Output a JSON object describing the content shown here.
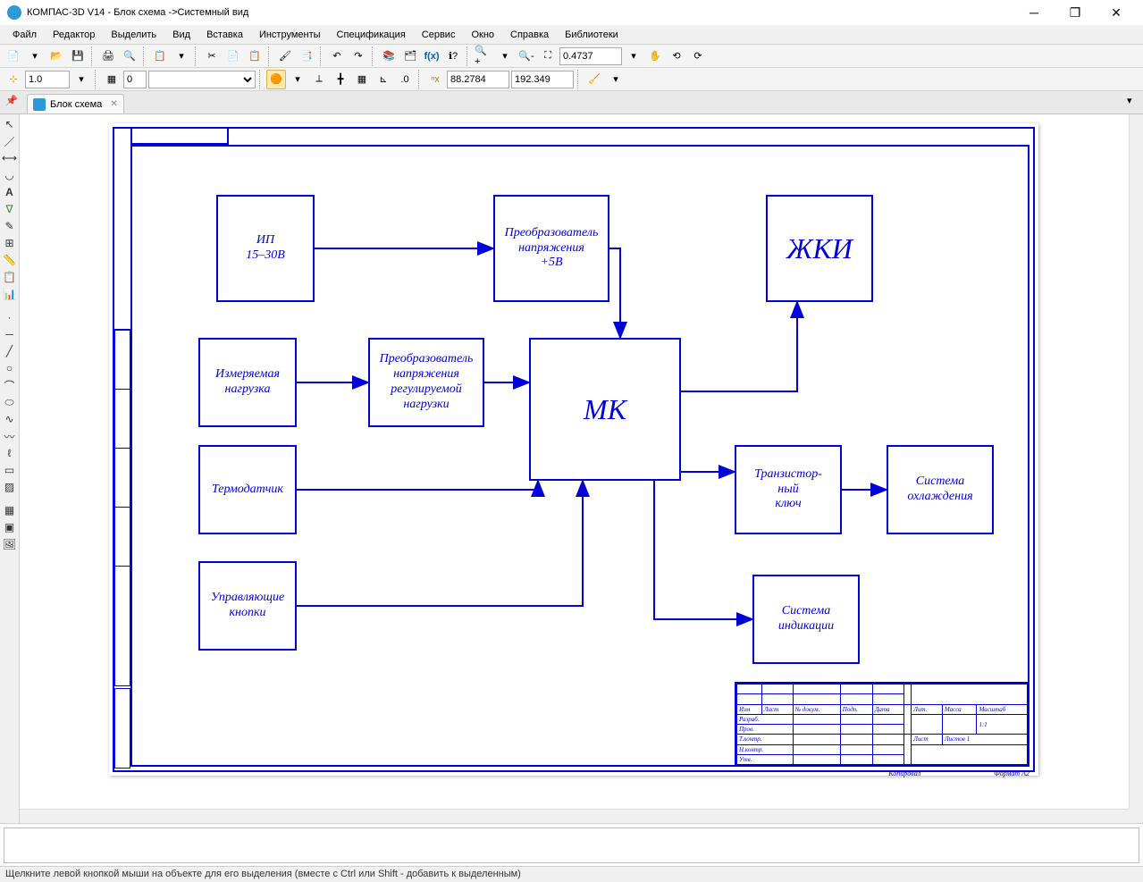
{
  "window": {
    "title": "КОМПАС-3D V14 - Блок схема ->Системный вид"
  },
  "menu": {
    "items": [
      "Файл",
      "Редактор",
      "Выделить",
      "Вид",
      "Вставка",
      "Инструменты",
      "Спецификация",
      "Сервис",
      "Окно",
      "Справка",
      "Библиотеки"
    ]
  },
  "toolbar1": {
    "zoom_value": "0.4737"
  },
  "toolbar2": {
    "scale": "1.0",
    "layer": "0",
    "coord_x": "88.2784",
    "coord_y": "192.349"
  },
  "tab": {
    "name": "Блок схема"
  },
  "diagram": {
    "blocks": {
      "power": "ИП\n15–30В",
      "converter5v": "Преобразователь\nнапряжения\n+5В",
      "lcd": "ЖКИ",
      "load": "Измеряемая\nнагрузка",
      "load_converter": "Преобразователь\nнапряжения\nрегулируемой\nнагрузки",
      "mcu": "МК",
      "thermo": "Термодатчик",
      "switch": "Транзистор-\nный\nключ",
      "cooling": "Система\nохлаждения",
      "buttons": "Управляющие\nкнопки",
      "indication": "Система\nиндикации"
    },
    "stamp": {
      "col_headers": [
        "Изм",
        "Лист",
        "№ докум.",
        "Подп.",
        "Дата"
      ],
      "rows": [
        "Разраб.",
        "Пров.",
        "Т.контр.",
        "",
        "Н.контр.",
        "Утв."
      ],
      "lit": "Лит.",
      "mass": "Масса",
      "scale_label": "Масштаб",
      "scale_val": "1:1",
      "sheet": "Лист",
      "sheets": "Листов 1",
      "copied": "Копировал",
      "format": "Формат   А2"
    }
  },
  "statusbar": {
    "text": "Щелкните левой кнопкой мыши на объекте для его выделения (вместе с Ctrl или Shift - добавить к выделенным)"
  }
}
